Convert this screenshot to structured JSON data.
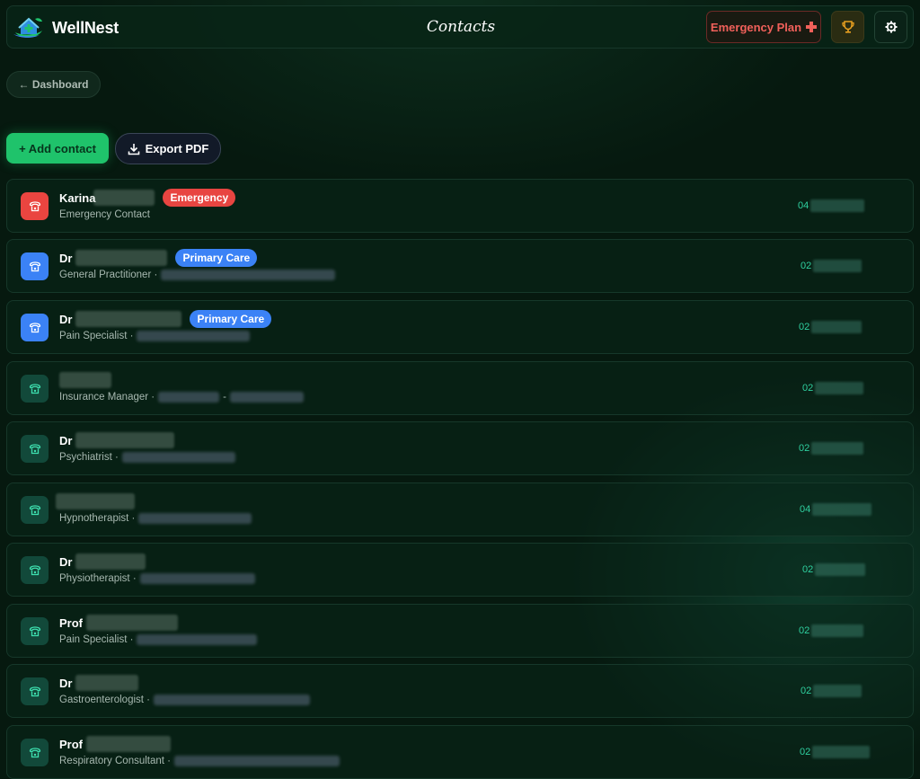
{
  "header": {
    "brand": "WellNest",
    "title": "Contacts",
    "emergency_plan_label": "Emergency Plan",
    "emergency_plan_icon": "plus-icon",
    "trophy_icon": "trophy-icon",
    "settings_icon": "gear-icon"
  },
  "nav": {
    "back_label": "← Dashboard"
  },
  "actions": {
    "add_contact_label": "+ Add contact",
    "export_pdf_label": "Export PDF"
  },
  "colors": {
    "accent_green": "#1fc36b",
    "emergency_red": "#ea4540",
    "primary_care_blue": "#3b82f6",
    "phone_teal": "#2fd0a0"
  },
  "contacts": [
    {
      "prefix": "Karina",
      "badge": "Emergency",
      "badge_color": "red",
      "role": "Emergency Contact",
      "phone_prefix": "04",
      "avatar": "red"
    },
    {
      "prefix": "Dr",
      "badge": "Primary Care",
      "badge_color": "blue",
      "role": "General Practitioner ·",
      "phone_prefix": "02",
      "avatar": "blue"
    },
    {
      "prefix": "Dr",
      "badge": "Primary Care",
      "badge_color": "blue",
      "role": "Pain Specialist ·",
      "phone_prefix": "02",
      "avatar": "blue"
    },
    {
      "prefix": "",
      "badge": "",
      "role": "Insurance Manager ·",
      "role_sep": "-",
      "phone_prefix": "02",
      "avatar": "teal"
    },
    {
      "prefix": "Dr",
      "badge": "",
      "role": "Psychiatrist ·",
      "phone_prefix": "02",
      "avatar": "teal"
    },
    {
      "prefix": "",
      "badge": "",
      "role": "Hypnotherapist ·",
      "phone_prefix": "04",
      "avatar": "teal"
    },
    {
      "prefix": "Dr",
      "badge": "",
      "role": "Physiotherapist ·",
      "phone_prefix": "02",
      "avatar": "teal"
    },
    {
      "prefix": "Prof",
      "badge": "",
      "role": "Pain Specialist ·",
      "phone_prefix": "02",
      "avatar": "teal"
    },
    {
      "prefix": "Dr",
      "badge": "",
      "role": "Gastroenterologist ·",
      "phone_prefix": "02",
      "avatar": "teal"
    },
    {
      "prefix": "Prof",
      "badge": "",
      "role": "Respiratory Consultant ·",
      "phone_prefix": "02",
      "avatar": "teal"
    }
  ]
}
